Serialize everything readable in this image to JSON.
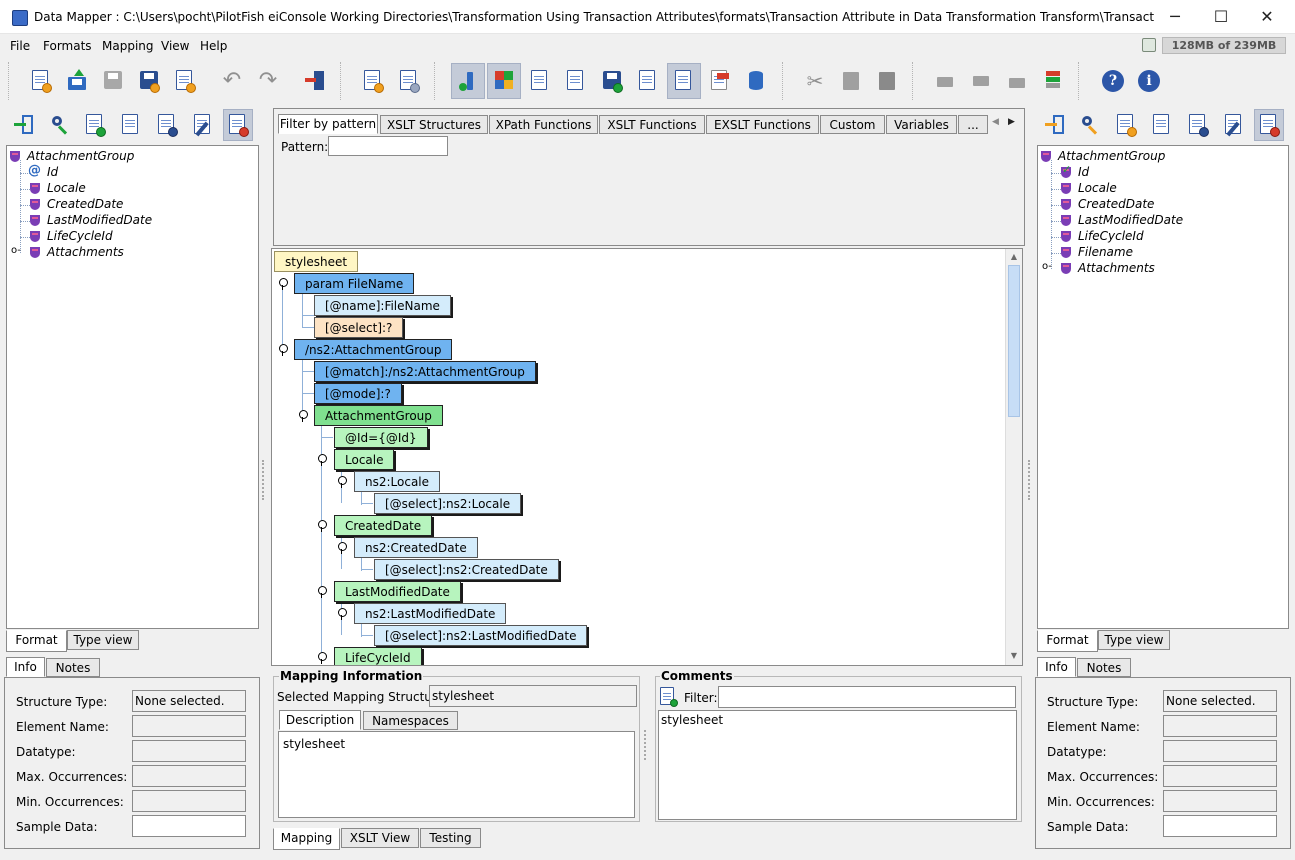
{
  "window": {
    "title": "Data Mapper : C:\\Users\\pocht\\PilotFish eiConsole Working Directories\\Transformation Using Transaction Attributes\\formats\\Transaction Attribute in Data Transformation Transform\\TransactionAttributeTransform...",
    "controls": {
      "minimize": "─",
      "maximize": "☐",
      "close": "✕"
    }
  },
  "menu": {
    "items": [
      {
        "label": "File"
      },
      {
        "label": "Formats"
      },
      {
        "label": "Mapping"
      },
      {
        "label": "View"
      },
      {
        "label": "Help"
      }
    ],
    "memory": "128MB of 239MB"
  },
  "left_panel": {
    "tree": [
      {
        "label": "AttachmentGroup",
        "icon": "element-icon"
      },
      {
        "label": "Id",
        "icon": "attribute-icon"
      },
      {
        "label": "Locale",
        "icon": "element-icon"
      },
      {
        "label": "CreatedDate",
        "icon": "element-icon"
      },
      {
        "label": "LastModifiedDate",
        "icon": "element-icon"
      },
      {
        "label": "LifeCycleId",
        "icon": "element-icon"
      },
      {
        "label": "Attachments",
        "icon": "element-icon"
      }
    ],
    "view_tabs": [
      "Format",
      "Type view"
    ],
    "info_tabs": [
      "Info",
      "Notes"
    ]
  },
  "right_panel": {
    "tree": [
      {
        "label": "AttachmentGroup",
        "icon": "element-icon"
      },
      {
        "label": "Id",
        "icon": "attribute-check-icon"
      },
      {
        "label": "Locale",
        "icon": "element-icon"
      },
      {
        "label": "CreatedDate",
        "icon": "element-icon"
      },
      {
        "label": "LastModifiedDate",
        "icon": "element-icon"
      },
      {
        "label": "LifeCycleId",
        "icon": "element-icon"
      },
      {
        "label": "Filename",
        "icon": "element-icon"
      },
      {
        "label": "Attachments",
        "icon": "element-icon"
      }
    ],
    "view_tabs": [
      "Format",
      "Type view"
    ],
    "info_tabs": [
      "Info",
      "Notes"
    ]
  },
  "info": {
    "structure_type_label": "Structure Type:",
    "structure_type_value": "None selected.",
    "element_name_label": "Element Name:",
    "datatype_label": "Datatype:",
    "max_occ_label": "Max. Occurrences:",
    "min_occ_label": "Min. Occurrences:",
    "sample_data_label": "Sample Data:"
  },
  "function_tabs": [
    "Filter by pattern",
    "XSLT Structures",
    "XPath Functions",
    "XSLT Functions",
    "EXSLT Functions",
    "Custom",
    "Variables",
    "..."
  ],
  "pattern_label": "Pattern:",
  "mapping_nodes": [
    {
      "label": "stylesheet",
      "color": "#fff6c4"
    },
    {
      "label": "param FileName",
      "color": "#6fb3f0"
    },
    {
      "label": "[@name]:FileName",
      "color": "#d4ecfb"
    },
    {
      "label": "[@select]:?",
      "color": "#fde3c4"
    },
    {
      "label": "/ns2:AttachmentGroup",
      "color": "#6fb3f0"
    },
    {
      "label": "[@match]:/ns2:AttachmentGroup",
      "color": "#6fb3f0"
    },
    {
      "label": "[@mode]:?",
      "color": "#6fb3f0"
    },
    {
      "label": "AttachmentGroup",
      "color": "#7fe08f"
    },
    {
      "label": "@Id={@Id}",
      "color": "#b7f4be"
    },
    {
      "label": "Locale",
      "color": "#7fe08f"
    },
    {
      "label": "ns2:Locale",
      "color": "#d4ecfb"
    },
    {
      "label": "[@select]:ns2:Locale",
      "color": "#d4ecfb"
    },
    {
      "label": "CreatedDate",
      "color": "#7fe08f"
    },
    {
      "label": "ns2:CreatedDate",
      "color": "#d4ecfb"
    },
    {
      "label": "[@select]:ns2:CreatedDate",
      "color": "#d4ecfb"
    },
    {
      "label": "LastModifiedDate",
      "color": "#7fe08f"
    },
    {
      "label": "ns2:LastModifiedDate",
      "color": "#d4ecfb"
    },
    {
      "label": "[@select]:ns2:LastModifiedDate",
      "color": "#d4ecfb"
    },
    {
      "label": "LifeCycleId",
      "color": "#7fe08f"
    }
  ],
  "mapping_info": {
    "title": "Mapping Information",
    "selected_label": "Selected Mapping Structure:",
    "selected_value": "stylesheet",
    "tabs": [
      "Description",
      "Namespaces"
    ],
    "description": "stylesheet"
  },
  "comments": {
    "title": "Comments",
    "filter_label": "Filter:",
    "text": "stylesheet"
  },
  "bottom_tabs": [
    "Mapping",
    "XSLT View",
    "Testing"
  ]
}
